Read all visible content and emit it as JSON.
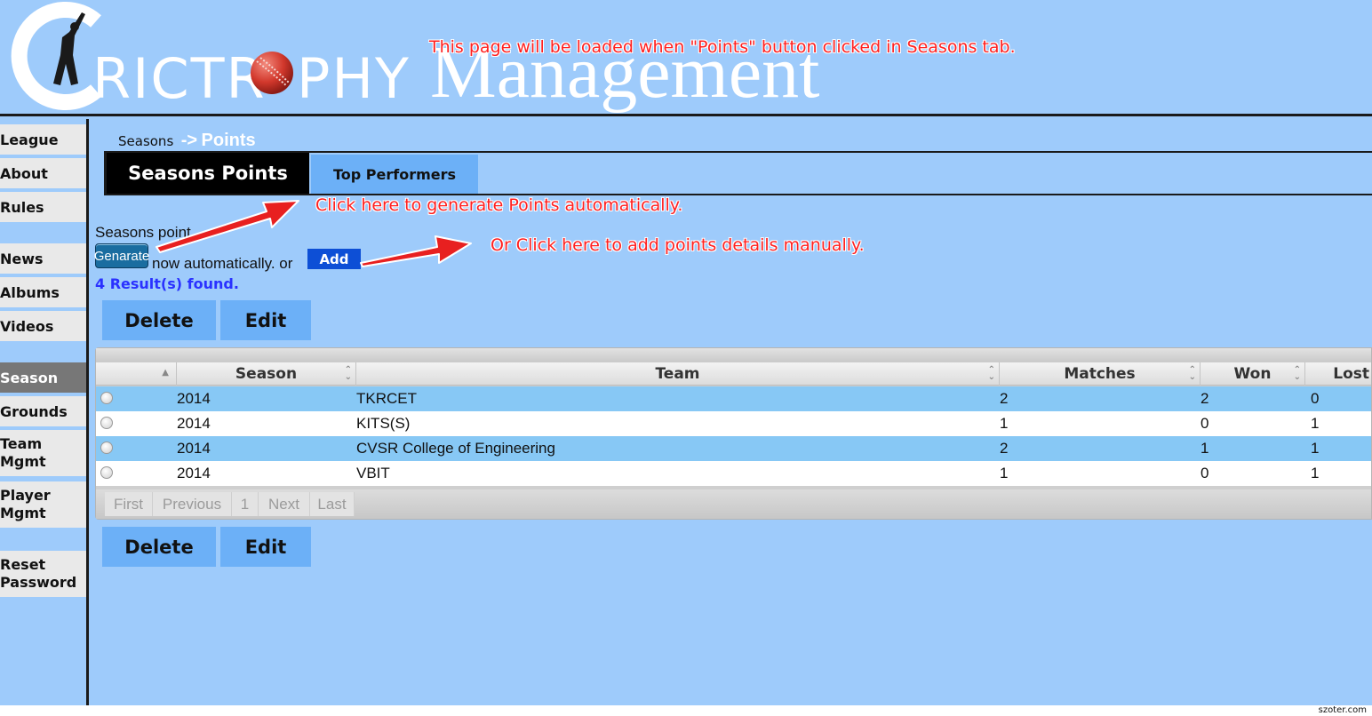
{
  "header": {
    "logo_part1": "RICTR",
    "logo_part2": "PHY",
    "logo_part3": "Management",
    "annotation": "This page will be loaded when \"Points\" button clicked in Seasons tab."
  },
  "sidebar": {
    "items": [
      {
        "label": "League"
      },
      {
        "label": "About"
      },
      {
        "label": "Rules"
      },
      {
        "label": "News"
      },
      {
        "label": "Albums"
      },
      {
        "label": "Videos"
      },
      {
        "label": "Season"
      },
      {
        "label": "Grounds"
      },
      {
        "label_l1": "Team",
        "label_l2": "Mgmt"
      },
      {
        "label_l1": "Player",
        "label_l2": "Mgmt"
      },
      {
        "label_l1": "Reset",
        "label_l2": "Password"
      }
    ]
  },
  "breadcrumb": {
    "parent": "Seasons",
    "separator": "->",
    "current": "Points"
  },
  "tabs": [
    {
      "label": "Seasons Points",
      "active": true
    },
    {
      "label": "Top Performers",
      "active": false
    }
  ],
  "actions": {
    "info_text": "Seasons point",
    "generate_label": "Genarate",
    "auto_text": "now automatically. or",
    "add_label": "Add",
    "result_count": "4 Result(s) found.",
    "delete_label": "Delete",
    "edit_label": "Edit"
  },
  "annotations": {
    "generate_hint": "Click here to generate Points automatically.",
    "add_hint": "Or Click here to add points details manually."
  },
  "table": {
    "columns": [
      "Season",
      "Team",
      "Matches",
      "Won",
      "Lost"
    ],
    "rows": [
      {
        "season": "2014",
        "team": "TKRCET",
        "matches": "2",
        "won": "2",
        "lost": "0"
      },
      {
        "season": "2014",
        "team": "KITS(S)",
        "matches": "1",
        "won": "0",
        "lost": "1"
      },
      {
        "season": "2014",
        "team": "CVSR College of Engineering",
        "matches": "2",
        "won": "1",
        "lost": "1"
      },
      {
        "season": "2014",
        "team": "VBIT",
        "matches": "1",
        "won": "0",
        "lost": "1"
      }
    ],
    "pager": [
      "First",
      "Previous",
      "1",
      "Next",
      "Last"
    ]
  },
  "footer": {
    "watermark": "szoter.com"
  },
  "colors": {
    "background": "#9ecbfb",
    "accent_button": "#6cb0f7",
    "annotation_red": "#ff2020",
    "row_highlight": "#87c8f5"
  }
}
